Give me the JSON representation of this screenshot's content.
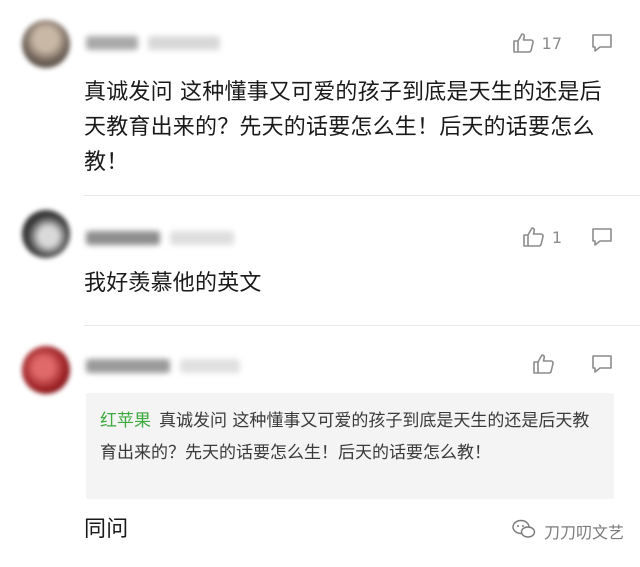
{
  "comments": [
    {
      "likes": "17",
      "text": "真诚发问 这种懂事又可爱的孩子到底是天生的还是后天教育出来的？先天的话要怎么生！后天的话要怎么教！"
    },
    {
      "likes": "1",
      "text": "我好羡慕他的英文"
    },
    {
      "likes": "",
      "quote": {
        "author": "红苹果",
        "text": "真诚发问 这种懂事又可爱的孩子到底是天生的还是后天教育出来的？先天的话要怎么生！后天的话要怎么教！"
      },
      "text": "同问"
    }
  ],
  "icons": {
    "like": "thumbs-up-icon",
    "reply": "comment-bubble-icon",
    "watermark": "wechat-icon"
  },
  "colors": {
    "quote_author": "#3caa3c",
    "quote_background": "#f4f4f4",
    "icon_gray": "#8c8c8c"
  },
  "watermark": {
    "text": "刀刀叨文艺"
  }
}
